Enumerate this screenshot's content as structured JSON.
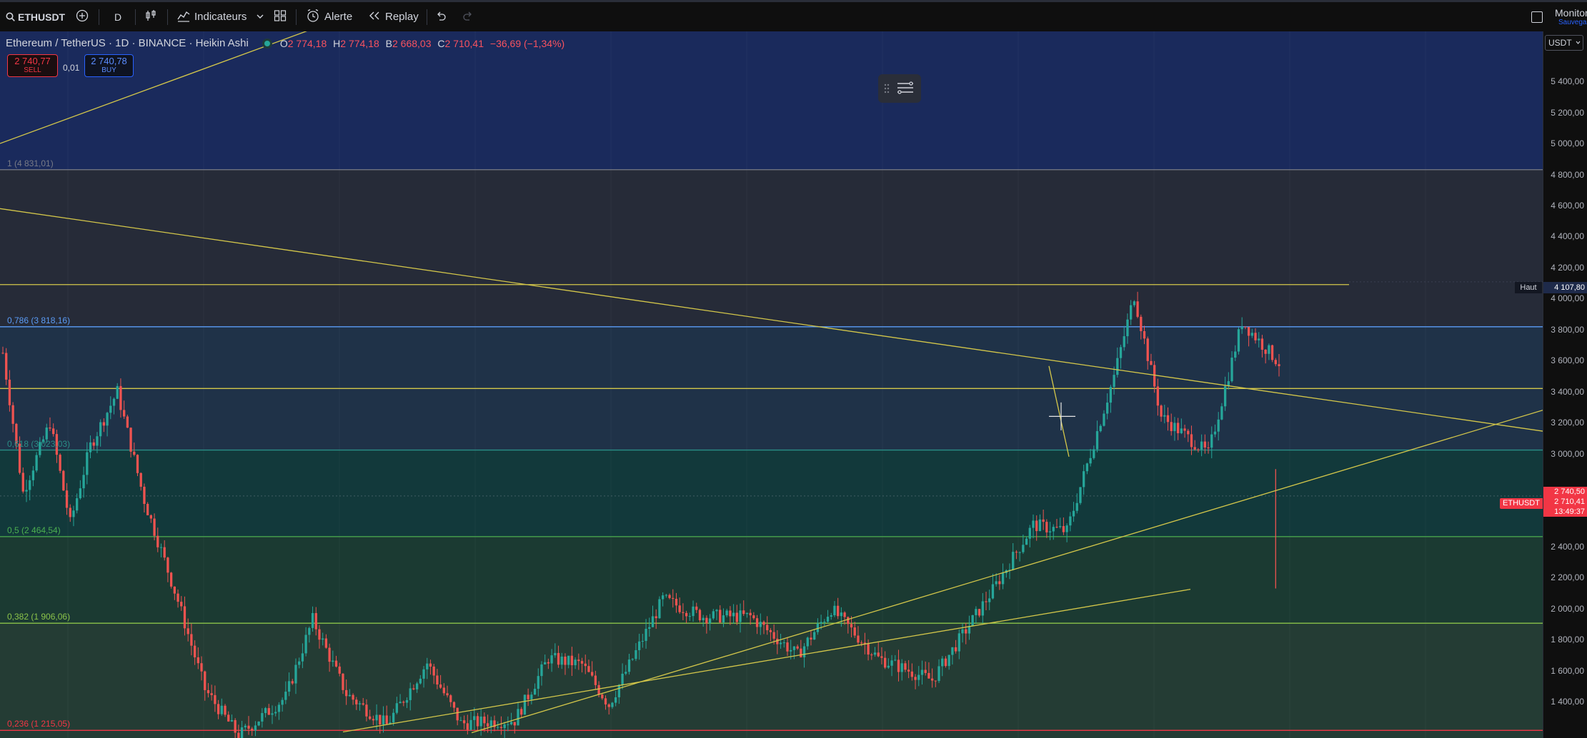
{
  "toolbar": {
    "symbol": "ETHUSDT",
    "interval": "D",
    "indicators_label": "Indicateurs",
    "alert_label": "Alerte",
    "replay_label": "Replay",
    "monitor_label": "Monitor",
    "save_label": "Sauvegar"
  },
  "legend": {
    "title": "Ethereum / TetherUS · 1D · BINANCE · Heikin Ashi",
    "open_key": "O",
    "open": "2 774,18",
    "high_key": "H",
    "high": "2 774,18",
    "low_key": "B",
    "low": "2 668,03",
    "close_key": "C",
    "close": "2 710,41",
    "change": "−36,69 (−1,34%)"
  },
  "trade": {
    "sell_price": "2 740,77",
    "sell_label": "SELL",
    "spread": "0,01",
    "buy_price": "2 740,78",
    "buy_label": "BUY"
  },
  "currency": "USDT",
  "fib_levels": [
    {
      "label": "1 (4 831,01)",
      "price": 4831.01,
      "color": "#787b86"
    },
    {
      "label": "0,786 (3 818,16)",
      "price": 3818.16,
      "color": "#5b9cf6"
    },
    {
      "label": "0,618 (3 023,03)",
      "price": 3023.03,
      "color": "#2a8e86"
    },
    {
      "label": "0,5 (2 464,54)",
      "price": 2464.54,
      "color": "#4caf50"
    },
    {
      "label": "0,382 (1 906,06)",
      "price": 1906.06,
      "color": "#8bc34a"
    },
    {
      "label": "0,236 (1 215,05)",
      "price": 1215.05,
      "color": "#f23645"
    }
  ],
  "price_axis": {
    "ticks": [
      "5 400,00",
      "5 200,00",
      "5 000,00",
      "4 800,00",
      "4 600,00",
      "4 400,00",
      "4 200,00",
      "4 000,00",
      "3 800,00",
      "3 600,00",
      "3 400,00",
      "3 200,00",
      "3 000,00",
      "2 400,00",
      "2 200,00",
      "2 000,00",
      "1 800,00",
      "1 600,00",
      "1 400,00"
    ],
    "high_label": "Haut",
    "high_value": "4 107,80",
    "ask_value": "2 740,50",
    "last_symbol": "ETHUSDT",
    "last_value": "2 710,41",
    "countdown": "13:49:37"
  },
  "colors": {
    "up": "#26a69a",
    "down": "#ef5350",
    "trendline": "#d4c74a",
    "background": "#131722"
  }
}
